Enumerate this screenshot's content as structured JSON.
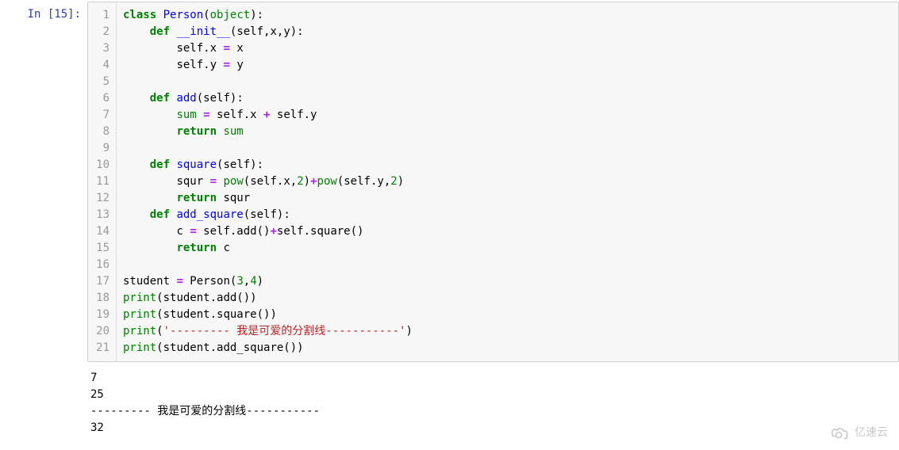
{
  "prompt": {
    "label": "In [15]:"
  },
  "line_numbers": [
    "1",
    "2",
    "3",
    "4",
    "5",
    "6",
    "7",
    "8",
    "9",
    "10",
    "11",
    "12",
    "13",
    "14",
    "15",
    "16",
    "17",
    "18",
    "19",
    "20",
    "21"
  ],
  "code": {
    "l1": {
      "indent": "",
      "k1": "class",
      "sp1": " ",
      "name": "Person",
      "paren1": "(",
      "base": "object",
      "paren2": "):"
    },
    "l2": {
      "indent": "    ",
      "k1": "def",
      "sp1": " ",
      "name": "__init__",
      "rest": "(self,x,y):"
    },
    "l3": {
      "indent": "        ",
      "lhs": "self.x ",
      "op": "=",
      "rhs": " x"
    },
    "l4": {
      "indent": "        ",
      "lhs": "self.y ",
      "op": "=",
      "rhs": " y"
    },
    "l5": {
      "text": ""
    },
    "l6": {
      "indent": "    ",
      "k1": "def",
      "sp1": " ",
      "name": "add",
      "rest": "(self):"
    },
    "l7": {
      "indent": "        ",
      "lhs": "sum",
      "sp": " ",
      "op": "=",
      "mid": " self.x ",
      "op2": "+",
      "tail": " self.y"
    },
    "l8": {
      "indent": "        ",
      "k1": "return",
      "sp1": " ",
      "val": "sum"
    },
    "l9": {
      "text": ""
    },
    "l10": {
      "indent": "    ",
      "k1": "def",
      "sp1": " ",
      "name": "square",
      "rest": "(self):"
    },
    "l11": {
      "indent": "        ",
      "a": "squr ",
      "op": "=",
      "b": " ",
      "fn1": "pow",
      "c": "(self.x,",
      "n1": "2",
      "d": ")",
      "op2": "+",
      "fn2": "pow",
      "e": "(self.y,",
      "n2": "2",
      "f": ")"
    },
    "l12": {
      "indent": "        ",
      "k1": "return",
      "sp1": " ",
      "val": "squr"
    },
    "l13": {
      "indent": "    ",
      "k1": "def",
      "sp1": " ",
      "name": "add_square",
      "rest": "(self):"
    },
    "l14": {
      "indent": "        ",
      "a": "c ",
      "op": "=",
      "b": " self.add()",
      "op2": "+",
      "c": "self.square()"
    },
    "l15": {
      "indent": "        ",
      "k1": "return",
      "sp1": " ",
      "val": "c"
    },
    "l16": {
      "text": ""
    },
    "l17": {
      "a": "student ",
      "op": "=",
      "b": " Person(",
      "n1": "3",
      "c": ",",
      "n2": "4",
      "d": ")"
    },
    "l18": {
      "fn": "print",
      "a": "(student.add())"
    },
    "l19": {
      "fn": "print",
      "a": "(student.square())"
    },
    "l20": {
      "fn": "print",
      "a": "(",
      "str": "'--------- 我是可爱的分割线-----------'",
      "b": ")"
    },
    "l21": {
      "fn": "print",
      "a": "(student.add_square())"
    }
  },
  "output": {
    "lines": [
      "7",
      "25",
      "--------- 我是可爱的分割线-----------",
      "32"
    ]
  },
  "watermark": {
    "text": "亿速云"
  }
}
